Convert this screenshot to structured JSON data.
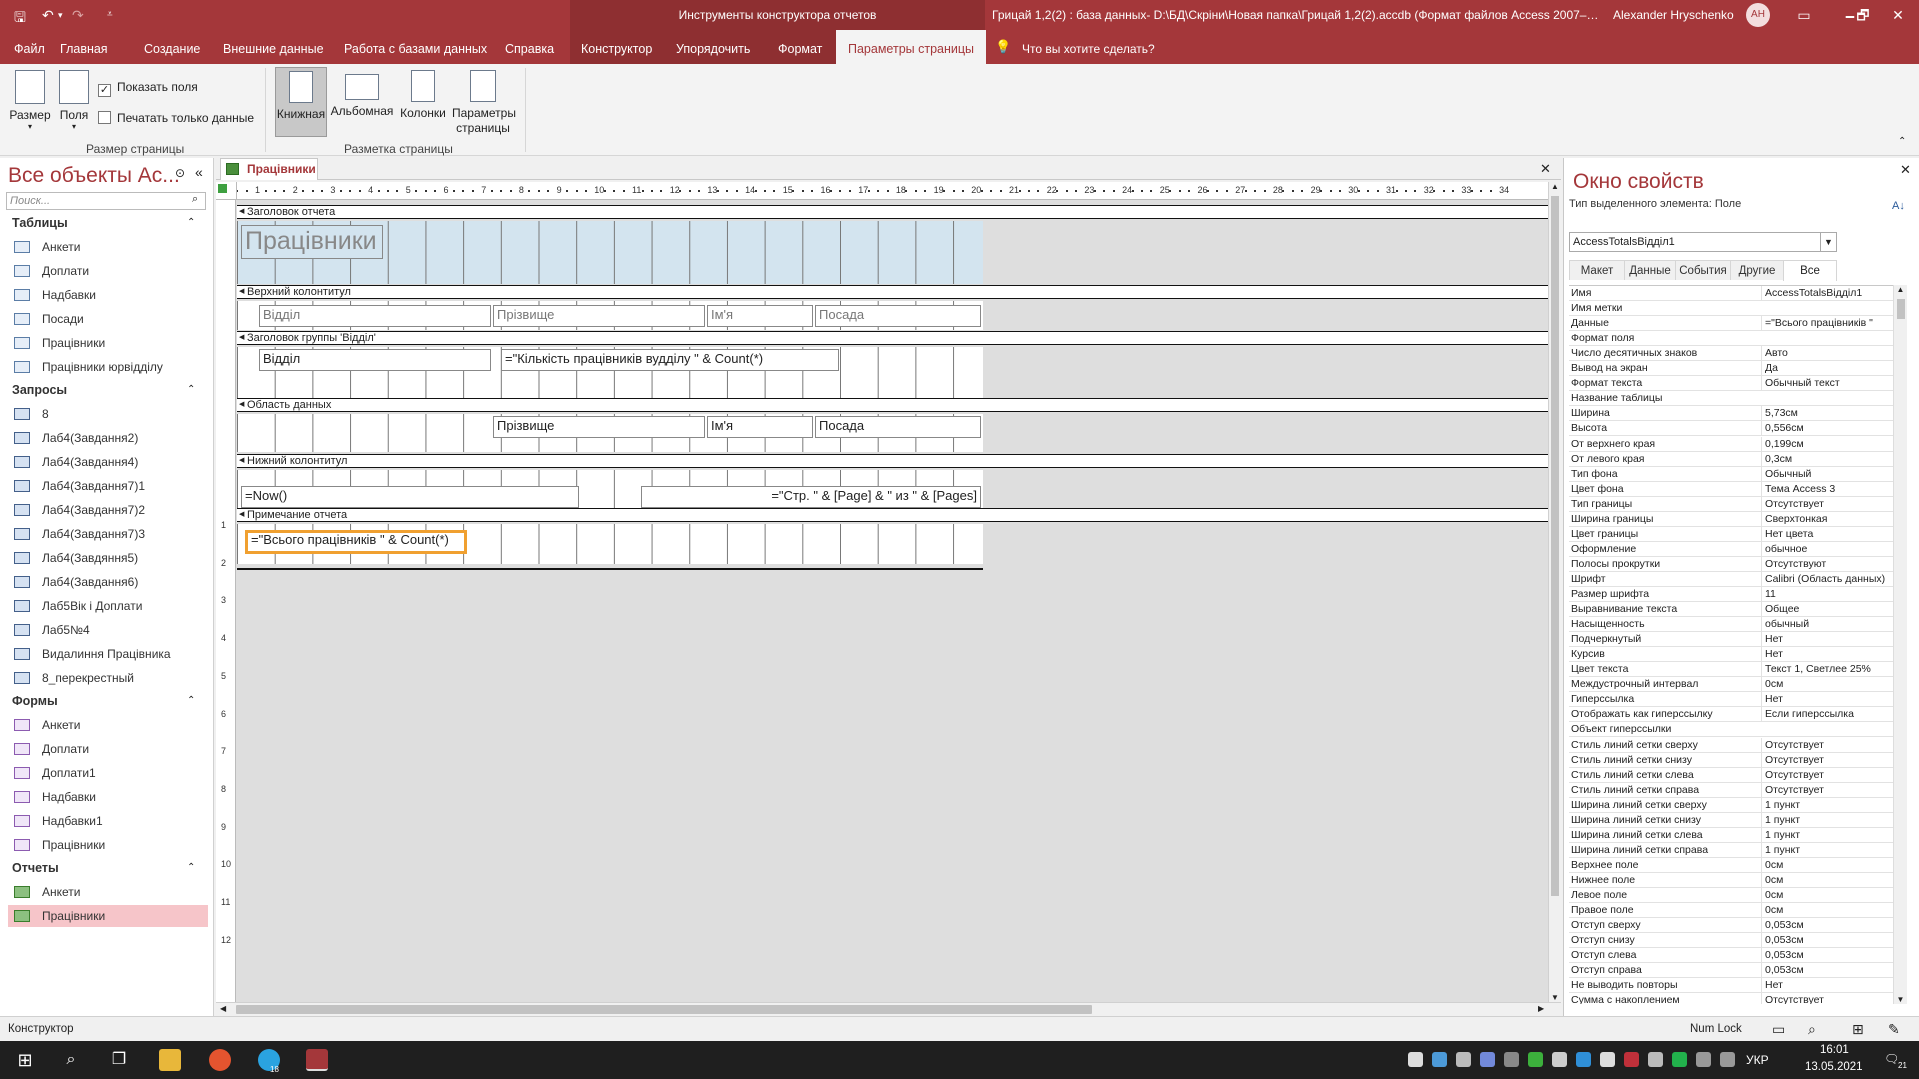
{
  "titlebar": {
    "context_title": "Инструменты конструктора отчетов",
    "doc_title": "Грицай 1,2(2) : база данных- D:\\БД\\Скріни\\Новая папка\\Грицай 1,2(2).accdb (Формат файлов Access 2007–…",
    "user_name": "Alexander Hryschenko",
    "user_initials": "AH",
    "minimize": "🗕",
    "maximize": "🗗",
    "close": "✕"
  },
  "tabs": [
    "Файл",
    "Главная",
    "Создание",
    "Внешние данные",
    "Работа с базами данных",
    "Справка",
    "Конструктор",
    "Упорядочить",
    "Формат",
    "Параметры страницы"
  ],
  "tell_me": "Что вы хотите сделать?",
  "ribbon": {
    "size_label": "Размер",
    "fields_label": "Поля",
    "show_fields": "Показать поля",
    "print_data_only": "Печатать только данные",
    "group_page_size": "Размер страницы",
    "portrait": "Книжная",
    "landscape": "Альбомная",
    "columns": "Колонки",
    "page_setup": "Параметры страницы",
    "group_page_layout": "Разметка страницы"
  },
  "nav": {
    "title": "Все объекты Ac...",
    "search_placeholder": "Поиск...",
    "groups": [
      {
        "name": "Таблицы",
        "items": [
          "Анкети",
          "Доплати",
          "Надбавки",
          "Посади",
          "Працівники",
          "Працівники юрвідділу"
        ]
      },
      {
        "name": "Запросы",
        "items": [
          "8",
          "Лаб4(Завдання2)",
          "Лаб4(Завдання4)",
          "Лаб4(Завдання7)1",
          "Лаб4(Завдання7)2",
          "Лаб4(Завдання7)3",
          "Лаб4(Завдяння5)",
          "Лаб4(Завдання6)",
          "Лаб5Вік і Доплати",
          "Лаб5№4",
          "Видалиння Працівника",
          "8_перекрестный"
        ]
      },
      {
        "name": "Формы",
        "items": [
          "Анкети",
          "Доплати",
          "Доплати1",
          "Надбавки",
          "Надбавки1",
          "Працівники"
        ]
      },
      {
        "name": "Отчеты",
        "items": [
          "Анкети",
          "Працівники"
        ]
      }
    ]
  },
  "document": {
    "tab_label": "Працівники",
    "close": "✕"
  },
  "report": {
    "ruler_numbers": [
      "1",
      "2",
      "3",
      "4",
      "5",
      "6",
      "7",
      "8",
      "9",
      "10",
      "11",
      "12",
      "13",
      "14",
      "15",
      "16",
      "17",
      "18",
      "19",
      "20",
      "21",
      "22",
      "23",
      "24",
      "25",
      "26",
      "27",
      "28",
      "29",
      "30",
      "31",
      "32",
      "33",
      "34"
    ],
    "vruler_numbers": [
      "1",
      "2",
      "3",
      "4",
      "5",
      "6",
      "7",
      "8",
      "9",
      "10",
      "11",
      "12"
    ],
    "sections": {
      "report_header": "Заголовок отчета",
      "page_header": "Верхний колонтитул",
      "group_header": "Заголовок группы 'Відділ'",
      "detail": "Область данных",
      "page_footer": "Нижний колонтитул",
      "report_footer": "Примечание отчета"
    },
    "title_label": "Працівники",
    "ph_labels": [
      "Відділ",
      "Прізвище",
      "Ім'я",
      "Посада"
    ],
    "group_field": "Відділ",
    "group_count_expr": "=\"Кількість працівників вудділу \" & Count(*)",
    "detail_fields": [
      "Прізвище",
      "Ім'я",
      "Посада"
    ],
    "now_expr": "=Now()",
    "page_expr": "=\"Стр. \" & [Page] & \" из \" & [Pages]",
    "total_expr": "=\"Всього працівників \" & Count(*)"
  },
  "props": {
    "title": "Окно свойств",
    "selection_type": "Тип выделенного элемента:  Поле",
    "sort_icon": "A↓",
    "close": "✕",
    "selected_control": "AccessTotalsВідділ1",
    "tabs": [
      "Макет",
      "Данные",
      "События",
      "Другие",
      "Все"
    ],
    "rows": [
      [
        "Имя",
        "AccessTotalsВідділ1"
      ],
      [
        "Имя метки",
        ""
      ],
      [
        "Данные",
        "=\"Всього працівників \""
      ],
      [
        "Формат поля",
        ""
      ],
      [
        "Число десятичных знаков",
        "Авто"
      ],
      [
        "Вывод на экран",
        "Да"
      ],
      [
        "Формат текста",
        "Обычный текст"
      ],
      [
        "Название таблицы",
        ""
      ],
      [
        "Ширина",
        "5,73см"
      ],
      [
        "Высота",
        "0,556см"
      ],
      [
        "От верхнего края",
        "0,199см"
      ],
      [
        "От левого края",
        "0,3см"
      ],
      [
        "Тип фона",
        "Обычный"
      ],
      [
        "Цвет фона",
        "Тема Access 3"
      ],
      [
        "Тип границы",
        "Отсутствует"
      ],
      [
        "Ширина границы",
        "Сверхтонкая"
      ],
      [
        "Цвет границы",
        "Нет цвета"
      ],
      [
        "Оформление",
        "обычное"
      ],
      [
        "Полосы прокрутки",
        "Отсутствуют"
      ],
      [
        "Шрифт",
        "Calibri (Область данных)"
      ],
      [
        "Размер шрифта",
        "11"
      ],
      [
        "Выравнивание текста",
        "Общее"
      ],
      [
        "Насыщенность",
        "обычный"
      ],
      [
        "Подчеркнутый",
        "Нет"
      ],
      [
        "Курсив",
        "Нет"
      ],
      [
        "Цвет текста",
        "Текст 1, Светлее 25%"
      ],
      [
        "Междустрочный интервал",
        "0см"
      ],
      [
        "Гиперссылка",
        "Нет"
      ],
      [
        "Отображать как гиперссылку",
        "Если гиперссылка"
      ],
      [
        "Объект гиперссылки",
        ""
      ],
      [
        "Стиль линий сетки сверху",
        "Отсутствует"
      ],
      [
        "Стиль линий сетки снизу",
        "Отсутствует"
      ],
      [
        "Стиль линий сетки слева",
        "Отсутствует"
      ],
      [
        "Стиль линий сетки справа",
        "Отсутствует"
      ],
      [
        "Ширина линий сетки сверху",
        "1 пункт"
      ],
      [
        "Ширина линий сетки снизу",
        "1 пункт"
      ],
      [
        "Ширина линий сетки слева",
        "1 пункт"
      ],
      [
        "Ширина линий сетки справа",
        "1 пункт"
      ],
      [
        "Верхнее поле",
        "0см"
      ],
      [
        "Нижнее поле",
        "0см"
      ],
      [
        "Левое поле",
        "0см"
      ],
      [
        "Правое поле",
        "0см"
      ],
      [
        "Отступ сверху",
        "0,053см"
      ],
      [
        "Отступ снизу",
        "0,053см"
      ],
      [
        "Отступ слева",
        "0,053см"
      ],
      [
        "Отступ справа",
        "0,053см"
      ],
      [
        "Не выводить повторы",
        "Нет"
      ],
      [
        "Сумма с накоплением",
        "Отсутствует"
      ]
    ]
  },
  "status": {
    "mode": "Конструктор",
    "num_lock": "Num Lock"
  },
  "taskbar": {
    "lang": "УКР",
    "time": "16:01",
    "date": "13.05.2021",
    "notif": "21",
    "badge": "18"
  },
  "colors": {
    "accent": "#a4373a",
    "selection": "#f0a030",
    "nav_selected": "#f6c5c9"
  }
}
